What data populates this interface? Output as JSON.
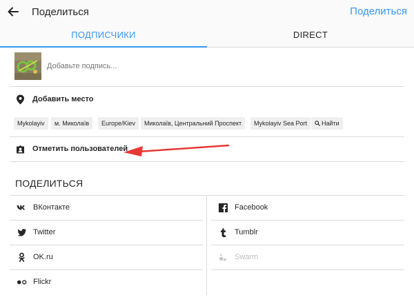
{
  "header": {
    "title": "Поделиться",
    "action_label": "Поделиться"
  },
  "tabs": [
    {
      "label": "ПОДПИСЧИКИ",
      "active": true
    },
    {
      "label": "DIRECT",
      "active": false
    }
  ],
  "caption": {
    "placeholder": "Добавьте подпись..."
  },
  "location": {
    "label": "Добавить место",
    "chips": [
      "Mykolayiv",
      "м. Миколаїв",
      "Europe/Kiev",
      "Миколаїв, Центральний Проспект",
      "Mykolayiv Sea Port",
      "Найти"
    ]
  },
  "tag_users": {
    "label": "Отметить пользователей"
  },
  "share": {
    "heading": "ПОДЕЛИТЬСЯ",
    "left": [
      "ВКонтакте",
      "Twitter",
      "OK.ru",
      "Flickr"
    ],
    "right": [
      "Facebook",
      "Tumblr",
      "Swarm"
    ]
  },
  "colors": {
    "accent": "#3897f0",
    "annotation": "#e53935"
  }
}
